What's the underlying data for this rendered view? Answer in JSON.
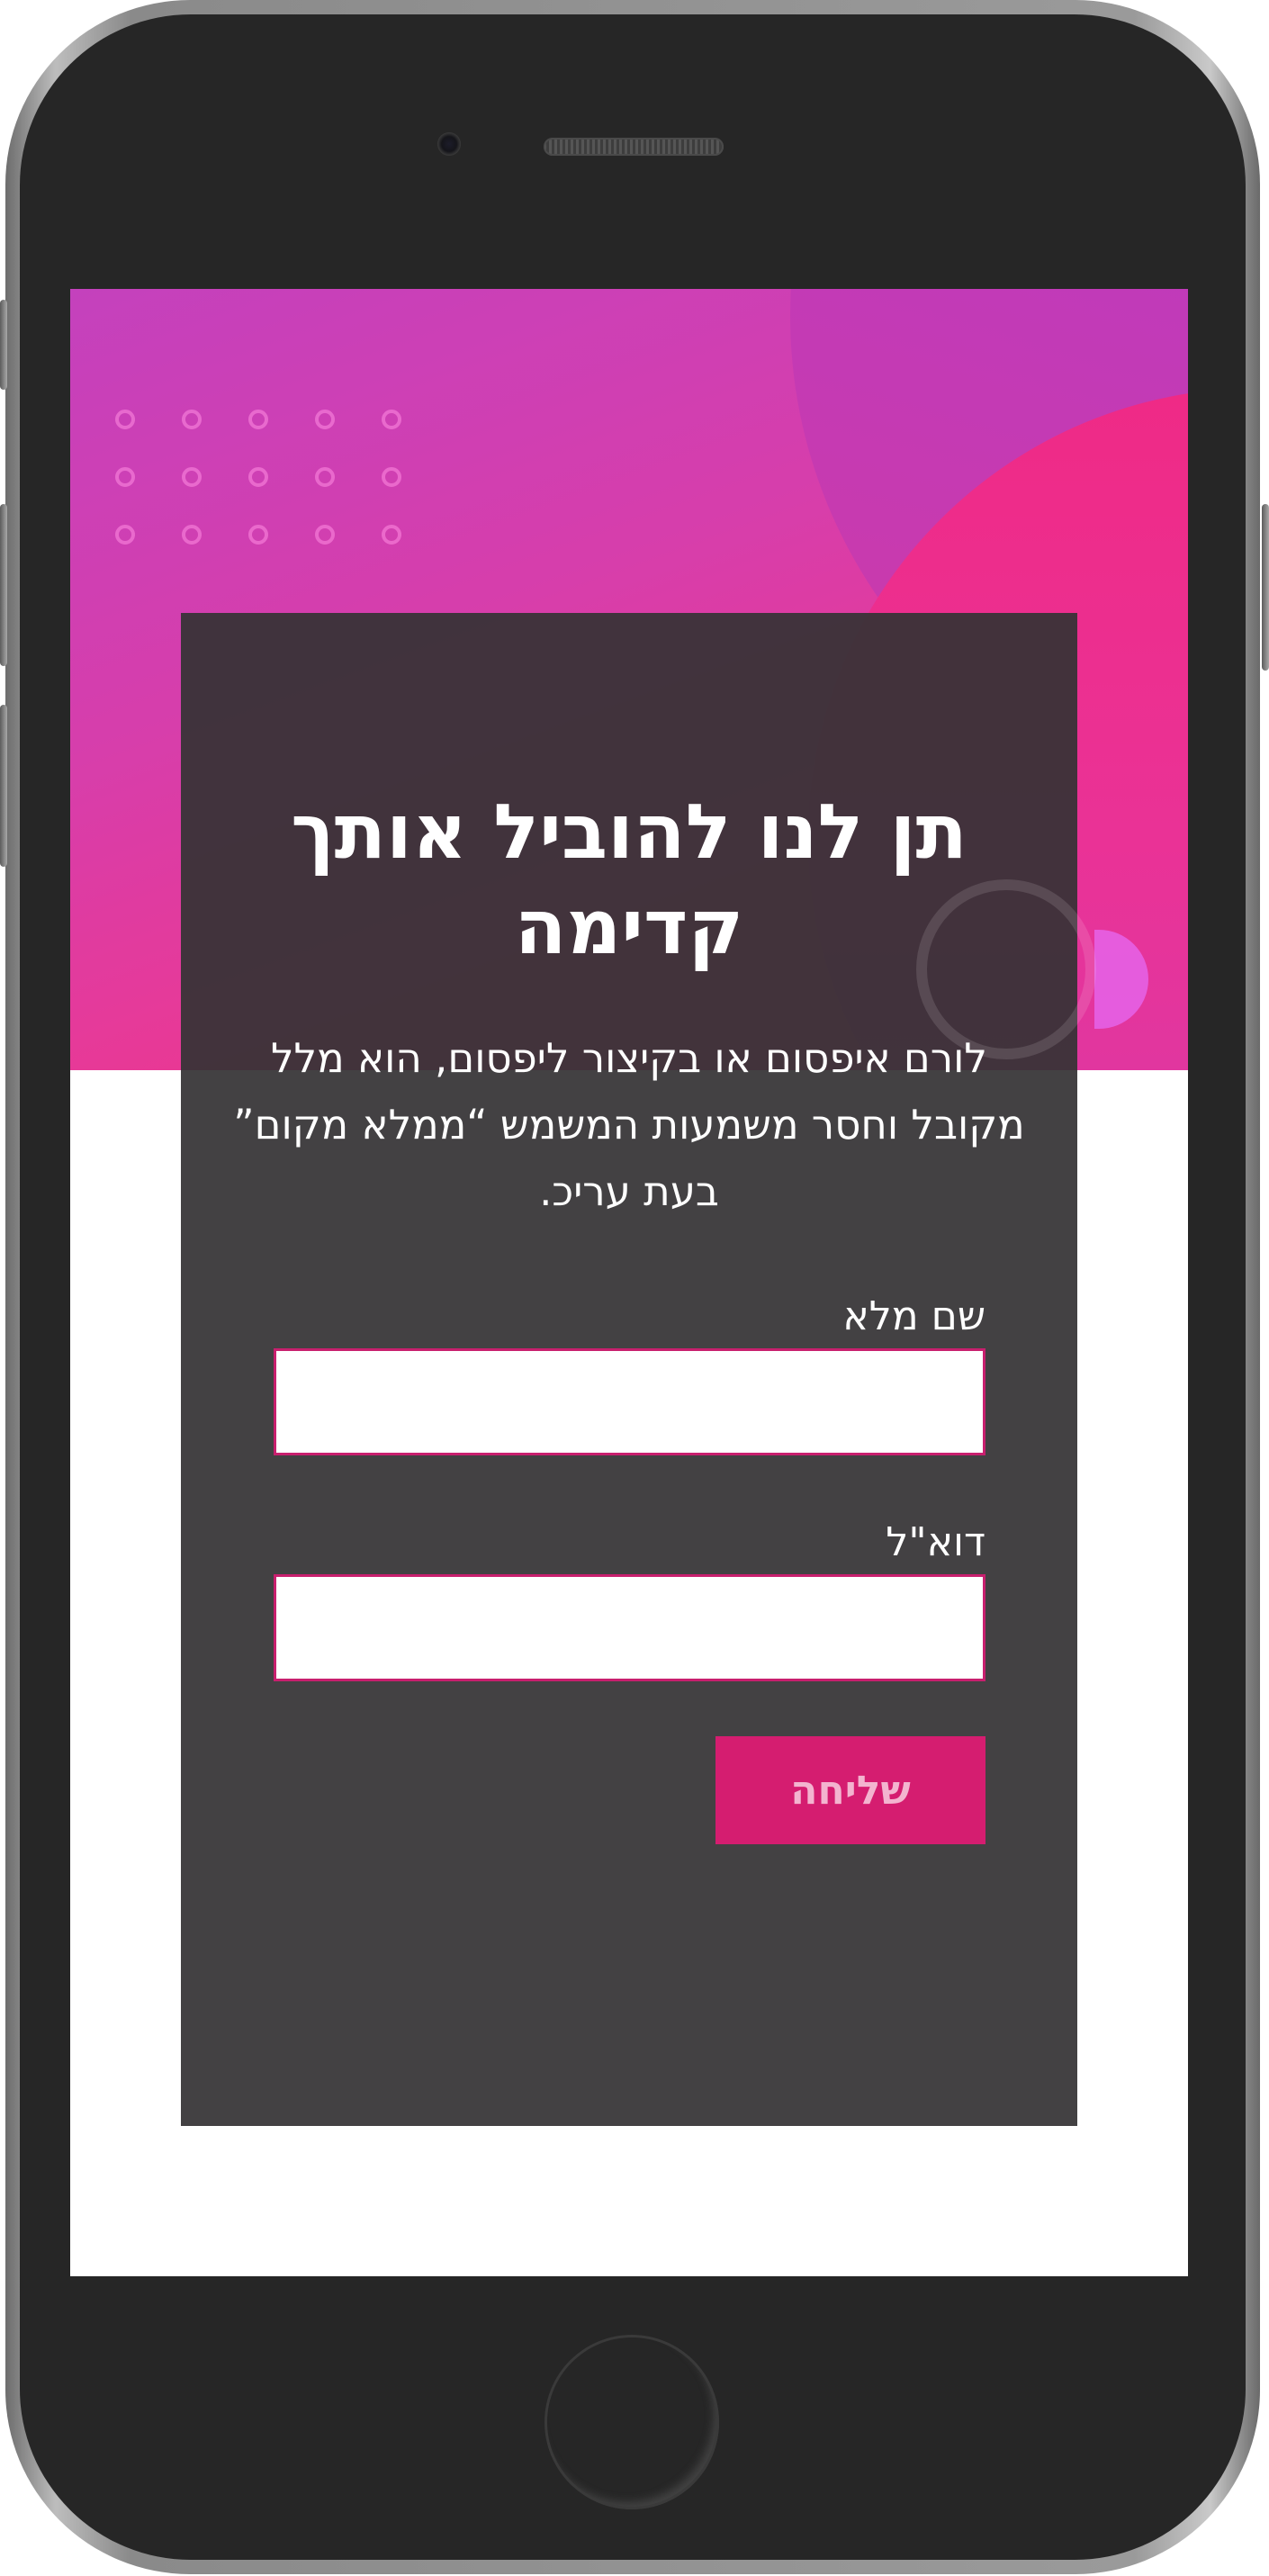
{
  "form": {
    "title": "תן לנו להוביל אותך קדימה",
    "description": "לורם איפסום או בקיצור ליפסום, הוא מלל מקובל וחסר משמעות המשמש “ממלא מקום” בעת עריכ.",
    "name_label": "שם מלא",
    "name_value": "",
    "email_label": "דוא\"ל",
    "email_value": "",
    "submit_label": "שליחה"
  },
  "colors": {
    "card_background": "#353335",
    "accent": "#d51d70",
    "input_border": "#c81f6e",
    "hero_gradient_start": "#c23abb",
    "hero_gradient_end": "#f0338a"
  },
  "icons": {
    "decoration": "dots-pattern",
    "ring": "circle-ring"
  }
}
